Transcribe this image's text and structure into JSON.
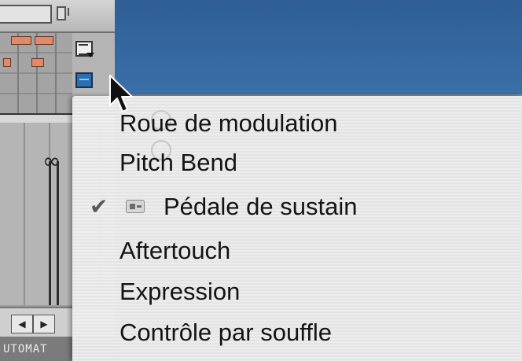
{
  "left_panel": {
    "loop_symbol": "∞",
    "nav_prev": "◀",
    "nav_next": "▶",
    "section_label": "UTOMAT"
  },
  "menu": {
    "items": [
      {
        "label": "Roue de modulation",
        "checked": false
      },
      {
        "label": "Pitch Bend",
        "checked": false
      },
      {
        "label": "Pédale de sustain",
        "checked": true,
        "icon": "pedal-icon"
      },
      {
        "label": "Aftertouch",
        "checked": false
      },
      {
        "label": "Expression",
        "checked": false
      },
      {
        "label": "Contrôle par souffle",
        "checked": false
      }
    ],
    "check_glyph": "✔"
  },
  "colors": {
    "desktop_blue": "#3b6fa8",
    "note_color": "#e08a6a",
    "tool_blue": "#2b6fb3"
  }
}
